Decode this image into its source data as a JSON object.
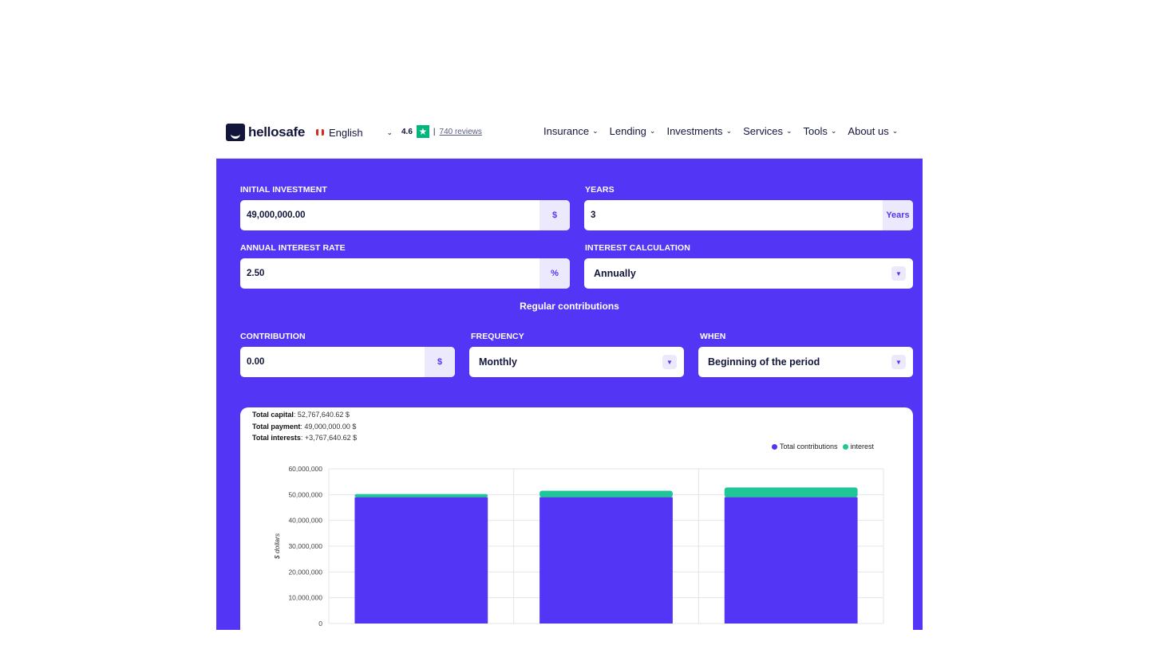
{
  "header": {
    "logo_text": "hellosafe",
    "language": "English",
    "rating": "4.6",
    "reviews": "740 reviews",
    "nav": [
      "Insurance",
      "Lending",
      "Investments",
      "Services",
      "Tools",
      "About us"
    ]
  },
  "form": {
    "initial_investment": {
      "label": "INITIAL INVESTMENT",
      "value": "49,000,000.00",
      "unit": "$"
    },
    "years": {
      "label": "YEARS",
      "value": "3",
      "unit": "Years"
    },
    "rate": {
      "label": "ANNUAL INTEREST RATE",
      "value": "2.50",
      "unit": "%"
    },
    "calc": {
      "label": "INTEREST CALCULATION",
      "value": "Annually"
    },
    "section_title": "Regular contributions",
    "contribution": {
      "label": "CONTRIBUTION",
      "value": "0.00",
      "unit": "$"
    },
    "frequency": {
      "label": "FREQUENCY",
      "value": "Monthly"
    },
    "when": {
      "label": "WHEN",
      "value": "Beginning of the period"
    }
  },
  "summary": {
    "capital_label": "Total capital",
    "capital_value": ": 52,767,640.62 $",
    "payment_label": "Total payment",
    "payment_value": ": 49,000,000.00 $",
    "interests_label": "Total interests",
    "interests_value": ": +3,767,640.62 $"
  },
  "colors": {
    "accent": "#5336f5",
    "interest": "#1fc796"
  },
  "chart_data": {
    "type": "bar",
    "stacked": true,
    "categories": [
      "",
      "",
      ""
    ],
    "series": [
      {
        "name": "Total contributions",
        "values": [
          49000000,
          49000000,
          49000000
        ],
        "color": "#5336f5"
      },
      {
        "name": "interest",
        "values": [
          1225000,
          2480625,
          3767640.62
        ],
        "color": "#1fc796"
      }
    ],
    "ylabel": "$ dollars",
    "ylim": [
      0,
      60000000
    ],
    "yticks": [
      "60,000,000",
      "50,000,000",
      "40,000,000",
      "30,000,000",
      "20,000,000",
      "10,000,000",
      "0"
    ],
    "legend": "top-right",
    "grid": true
  }
}
